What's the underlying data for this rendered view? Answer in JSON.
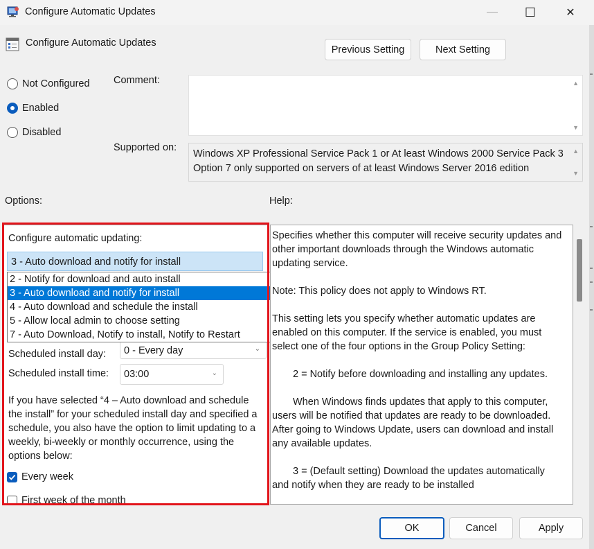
{
  "window": {
    "title": "Configure Automatic Updates",
    "minimize_glyph": "—",
    "maximize_glyph": "☐",
    "close_glyph": "✕"
  },
  "header": {
    "policy_title": "Configure Automatic Updates",
    "previous_label": "Previous Setting",
    "next_label": "Next Setting"
  },
  "state": {
    "options": [
      {
        "label": "Not Configured",
        "selected": false
      },
      {
        "label": "Enabled",
        "selected": true
      },
      {
        "label": "Disabled",
        "selected": false
      }
    ]
  },
  "comment": {
    "label": "Comment:",
    "value": ""
  },
  "supported": {
    "label": "Supported on:",
    "lines": [
      "Windows XP Professional Service Pack 1 or At least Windows 2000 Service Pack 3",
      "Option 7 only supported on servers of at least Windows Server 2016 edition"
    ]
  },
  "options_label": "Options:",
  "help_label": "Help:",
  "options": {
    "configure_label": "Configure automatic updating:",
    "selected_value": "3 - Auto download and notify for install",
    "dropdown_items": [
      "2 - Notify for download and auto install",
      "3 - Auto download and notify for install",
      "4 - Auto download and schedule the install",
      "5 - Allow local admin to choose setting",
      "7 - Auto Download, Notify to install, Notify to Restart"
    ],
    "dropdown_selected_index": 1,
    "install_day_label": "Scheduled install day:",
    "install_day_value": "0 - Every day",
    "install_time_label": "Scheduled install time:",
    "install_time_value": "03:00",
    "note_lines": [
      "If you have selected “4 – Auto download and schedule",
      "the install” for your scheduled install day and specified a",
      "schedule, you also have the option to limit updating to a",
      "weekly, bi-weekly or monthly occurrence, using the",
      "options below:"
    ],
    "every_week_label": "Every week",
    "every_week_checked": true,
    "first_week_label": "First week of the month",
    "first_week_checked": false
  },
  "help": {
    "p1": [
      "Specifies whether this computer will receive security updates and",
      "other important downloads through the Windows automatic",
      "updating service."
    ],
    "p2": [
      "Note: This policy does not apply to Windows RT."
    ],
    "p3": [
      "This setting lets you specify whether automatic updates are",
      "enabled on this computer. If the service is enabled, you must",
      "select one of the four options in the Group Policy Setting:"
    ],
    "p4": [
      "2 = Notify before downloading and installing any updates."
    ],
    "p5": [
      "When Windows finds updates that apply to this computer,",
      "users will be notified that updates are ready to be downloaded.",
      "After going to Windows Update, users can download and install",
      "any available updates."
    ],
    "p6": [
      "3 = (Default setting) Download the updates automatically",
      "and notify when they are ready to be installed"
    ]
  },
  "footer": {
    "ok_label": "OK",
    "cancel_label": "Cancel",
    "apply_label": "Apply"
  },
  "colors": {
    "accent": "#0078d7",
    "highlight": "#e2141b",
    "dropdown_selected_bg": "#cce4f7"
  }
}
